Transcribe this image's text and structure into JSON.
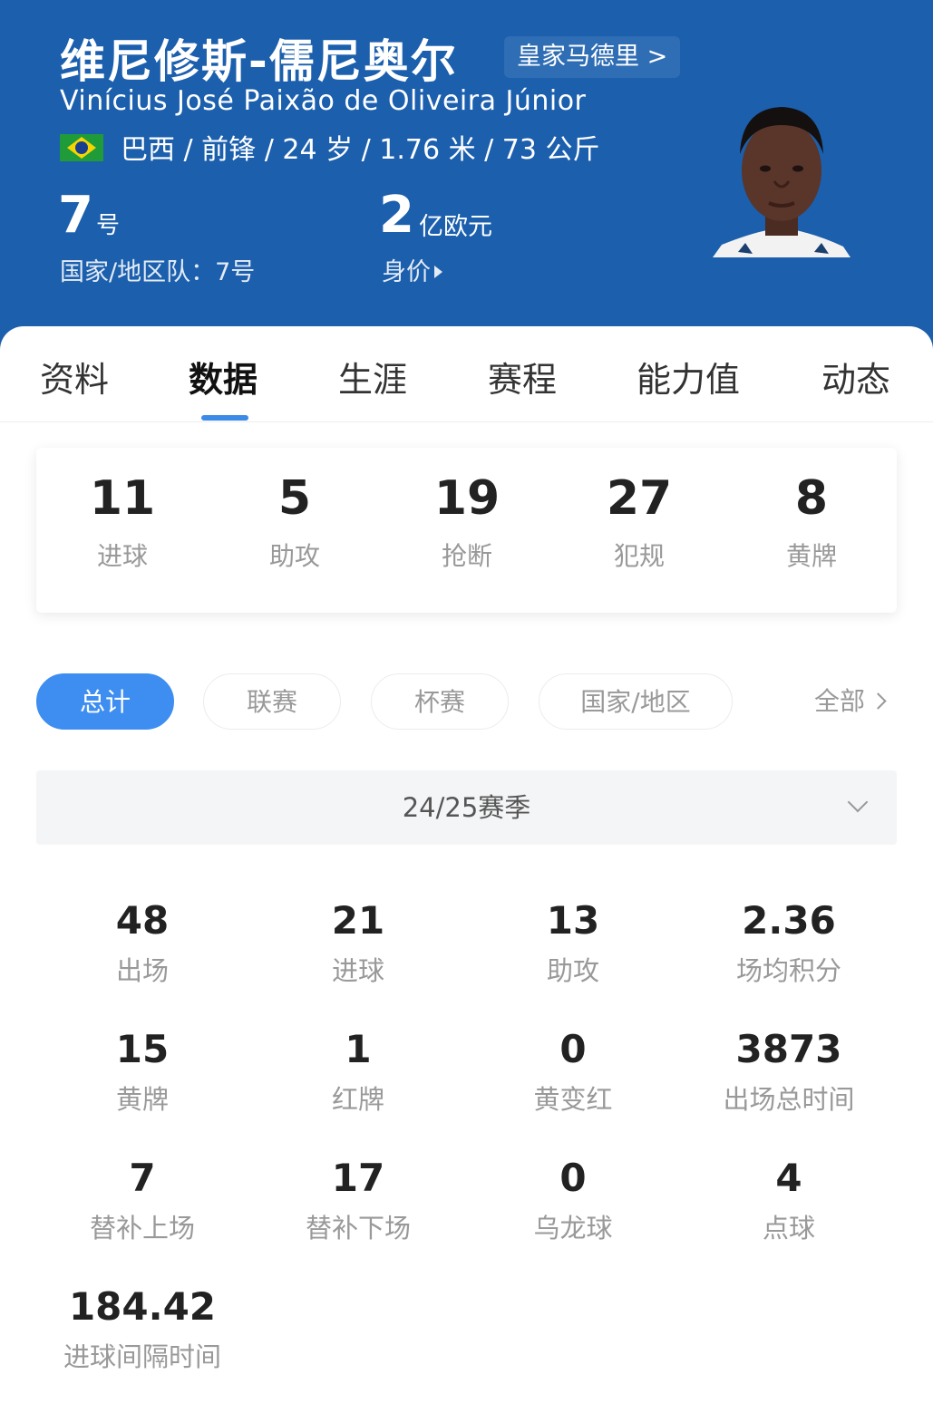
{
  "header": {
    "name_cn": "维尼修斯-儒尼奥尔",
    "team_link": "皇家马德里 >",
    "name_en": "Vinícius José Paixão de Oliveira Júnior",
    "bio": "巴西 / 前锋 / 24 岁 / 1.76 米 / 73 公斤",
    "flag_icon": "brazil-flag-icon",
    "shirt_number": "7",
    "shirt_unit": "号",
    "national_team": "国家/地区队：7号",
    "market_value": "2",
    "market_unit": "亿欧元",
    "market_label": "身价",
    "colors": {
      "header_bg": "#1b5fad",
      "accent": "#3d8ef0"
    }
  },
  "tabs": [
    {
      "label": "资料"
    },
    {
      "label": "数据",
      "active": true
    },
    {
      "label": "生涯"
    },
    {
      "label": "赛程"
    },
    {
      "label": "能力值"
    },
    {
      "label": "动态"
    }
  ],
  "summary": [
    {
      "value": "11",
      "label": "进球"
    },
    {
      "value": "5",
      "label": "助攻"
    },
    {
      "value": "19",
      "label": "抢断"
    },
    {
      "value": "27",
      "label": "犯规"
    },
    {
      "value": "8",
      "label": "黄牌"
    }
  ],
  "filters": [
    {
      "label": "总计",
      "active": true
    },
    {
      "label": "联赛"
    },
    {
      "label": "杯赛"
    },
    {
      "label": "国家/地区"
    }
  ],
  "all_label": "全部",
  "season": "24/25赛季",
  "stats": [
    {
      "value": "48",
      "label": "出场"
    },
    {
      "value": "21",
      "label": "进球"
    },
    {
      "value": "13",
      "label": "助攻"
    },
    {
      "value": "2.36",
      "label": "场均积分"
    },
    {
      "value": "15",
      "label": "黄牌"
    },
    {
      "value": "1",
      "label": "红牌"
    },
    {
      "value": "0",
      "label": "黄变红"
    },
    {
      "value": "3873",
      "label": "出场总时间"
    },
    {
      "value": "7",
      "label": "替补上场"
    },
    {
      "value": "17",
      "label": "替补下场"
    },
    {
      "value": "0",
      "label": "乌龙球"
    },
    {
      "value": "4",
      "label": "点球"
    },
    {
      "value": "184.42",
      "label": "进球间隔时间"
    }
  ]
}
